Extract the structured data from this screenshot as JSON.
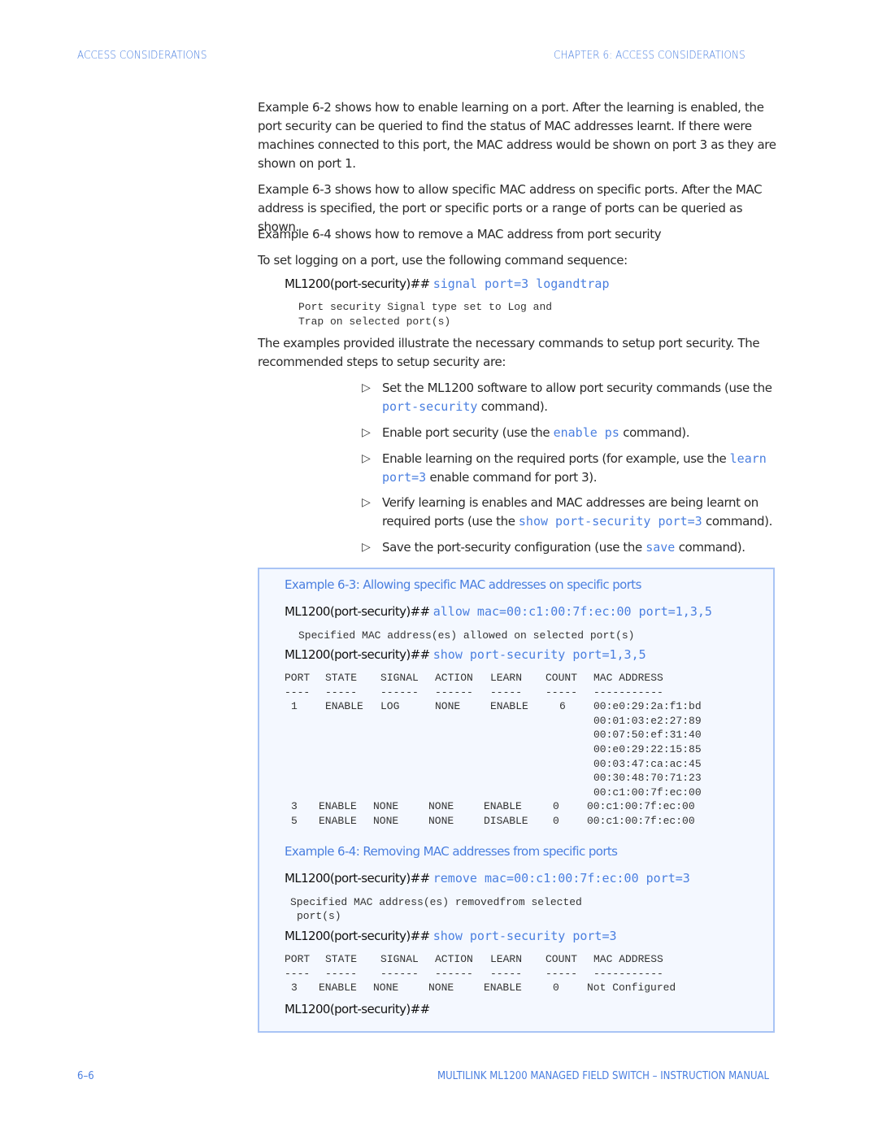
{
  "header": {
    "left": "ACCESS CONSIDERATIONS",
    "right": "CHAPTER 6: ACCESS CONSIDERATIONS"
  },
  "paragraphs": [
    "Example 6-2 shows how to enable learning on a port. After the learning is enabled, the port security can be queried to find the status of MAC addresses learnt. If there were machines connected to this port, the MAC address would be shown on port 3 as they are shown on port 1.",
    "Example 6-3 shows how to allow specific MAC address on specific ports. After the MAC address is specified, the port or specific ports or a range of ports can be queried as shown.",
    "Example 6-4 shows how to remove a MAC address from port security",
    "To set logging on a port, use the following command sequence:"
  ],
  "logging_command": {
    "prompt": "ML1200(port-security)##",
    "command": "signal port=3 logandtrap",
    "output": [
      "Port security Signal type set to Log and",
      "Trap on selected port(s)"
    ]
  },
  "steps_intro": "The examples provided illustrate the necessary commands to setup port security. The recommended steps to setup security are:",
  "steps": [
    {
      "before": "Set the ML1200 software to allow port security commands (use the ",
      "code": "port-security",
      "after": " command)."
    },
    {
      "before": "Enable port security (use the ",
      "code": "enable ps",
      "after": " command)."
    },
    {
      "before": "Enable learning on the required ports (for example, use the ",
      "code": "learn port=3",
      "after": " enable command for port 3)."
    },
    {
      "before": "Verify learning is enables and MAC addresses are being learnt on required ports (use the ",
      "code": "show port-security port=3",
      "after": " command)."
    },
    {
      "before": "Save the port-security configuration (use the ",
      "code": "save",
      "after": " command)."
    }
  ],
  "example_6_3": {
    "title": "Example 6-3: Allowing specific MAC addresses on specific ports",
    "cmd1": {
      "prompt": "ML1200(port-security)##",
      "command": "allow mac=00:c1:00:7f:ec:00 port=1,3,5"
    },
    "cmd1_output": "Specified MAC address(es) allowed on selected port(s)",
    "cmd2": {
      "prompt": "ML1200(port-security)##",
      "command": "show port-security port=1,3,5"
    },
    "table": {
      "headers": [
        "PORT",
        "STATE",
        "SIGNAL",
        "ACTION",
        "LEARN",
        "COUNT",
        "MAC ADDRESS"
      ],
      "dashes": [
        "----",
        "-----",
        "------",
        "------",
        "-----",
        "-----",
        "-----------"
      ],
      "rows": [
        {
          "port": "1",
          "state": "ENABLE",
          "signal": "LOG",
          "action": "NONE",
          "learn": "ENABLE",
          "count": "6",
          "macs": [
            "00:e0:29:2a:f1:bd",
            "00:01:03:e2:27:89",
            "00:07:50:ef:31:40",
            "00:e0:29:22:15:85",
            "00:03:47:ca:ac:45",
            "00:30:48:70:71:23",
            "00:c1:00:7f:ec:00"
          ]
        },
        {
          "port": "3",
          "state": "ENABLE",
          "signal": "NONE",
          "action": "NONE",
          "learn": "ENABLE",
          "count": "0",
          "macs": [
            "00:c1:00:7f:ec:00"
          ]
        },
        {
          "port": "5",
          "state": "ENABLE",
          "signal": "NONE",
          "action": "NONE",
          "learn": "DISABLE",
          "count": "0",
          "macs": [
            "00:c1:00:7f:ec:00"
          ]
        }
      ]
    }
  },
  "example_6_4": {
    "title": "Example 6-4: Removing MAC addresses from specific ports",
    "cmd1": {
      "prompt": "ML1200(port-security)##",
      "command": "remove mac=00:c1:00:7f:ec:00 port=3"
    },
    "cmd1_output": [
      "Specified MAC address(es) removedfrom selected",
      "port(s)"
    ],
    "cmd2": {
      "prompt": "ML1200(port-security)##",
      "command": "show port-security port=3"
    },
    "table": {
      "headers": [
        "PORT",
        "STATE",
        "SIGNAL",
        "ACTION",
        "LEARN",
        "COUNT",
        "MAC ADDRESS"
      ],
      "dashes": [
        "----",
        "-----",
        "------",
        "------",
        "-----",
        "-----",
        "-----------"
      ],
      "rows": [
        {
          "port": "3",
          "state": "ENABLE",
          "signal": "NONE",
          "action": "NONE",
          "learn": "ENABLE",
          "count": "0",
          "macs": [
            "Not Configured"
          ]
        }
      ]
    },
    "final_prompt": "ML1200(port-security)##"
  },
  "footer": {
    "page": "6–6",
    "title": "MULTILINK ML1200 MANAGED FIELD SWITCH – INSTRUCTION MANUAL"
  },
  "colors": {
    "accent": "#4a7fe0",
    "box_bg": "#f4f8ff",
    "box_border": "#a9c4f5"
  }
}
